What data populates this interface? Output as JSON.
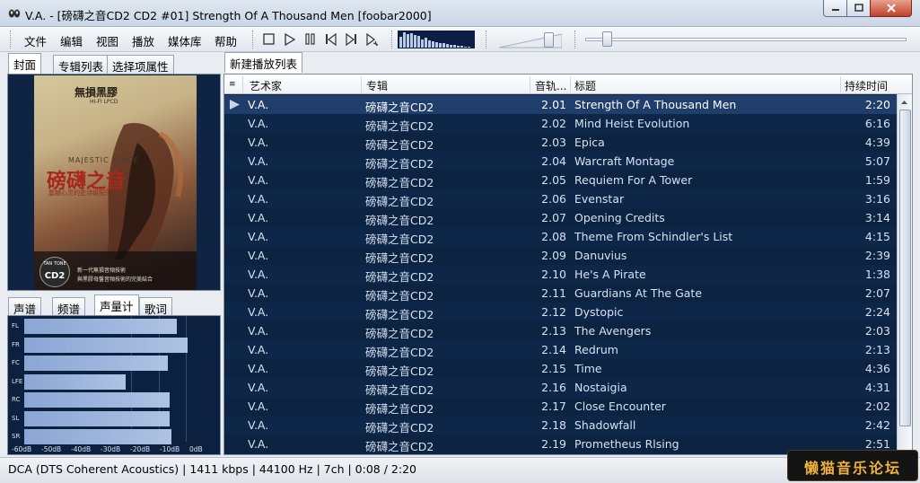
{
  "window": {
    "title": "V.A. - [磅礴之音CD2 CD2 #01] Strength Of A Thousand Men  [foobar2000]"
  },
  "menu": [
    "文件",
    "编辑",
    "视图",
    "播放",
    "媒体库",
    "帮助"
  ],
  "playback": {
    "volume_level": 0.85,
    "seek_position": 0.055
  },
  "left_tabs": [
    "封面",
    "专辑列表",
    "选择项属性"
  ],
  "cover": {
    "top_text": "無損黑膠",
    "sub_text": "HI-FI LPCD",
    "brand": "MAJESTIC VOICE",
    "title": "磅礴之音",
    "caption": "震撼心灵的史诗级配乐",
    "badge_logo": "TAN TONE",
    "badge_cd": "CD2",
    "bottom_line1": "新一代無損音頻技術",
    "bottom_line2": "與黑膠母盤音頻技術的完美結合"
  },
  "vis_tabs": [
    "声谱",
    "频谱",
    "声量计",
    "歌词"
  ],
  "meter": {
    "channels": [
      {
        "name": "FL",
        "level": 0.83
      },
      {
        "name": "FR",
        "level": 0.89
      },
      {
        "name": "FC",
        "level": 0.78
      },
      {
        "name": "LFE",
        "level": 0.55
      },
      {
        "name": "RC",
        "level": 0.79
      },
      {
        "name": "SL",
        "level": 0.79
      },
      {
        "name": "SR",
        "level": 0.8
      }
    ],
    "scale": [
      "-60dB",
      "-50dB",
      "-40dB",
      "-30dB",
      "-20dB",
      "-10dB",
      "0dB"
    ]
  },
  "playlist_tab": "新建播放列表",
  "columns": [
    "艺术家",
    "专辑",
    "音轨...",
    "标题",
    "持续时间"
  ],
  "tracks": [
    {
      "artist": "V.A.",
      "album": "磅礴之音CD2",
      "track": "2.01",
      "title": "Strength Of A Thousand Men",
      "duration": "2:20",
      "playing": true
    },
    {
      "artist": "V.A.",
      "album": "磅礴之音CD2",
      "track": "2.02",
      "title": "Mind Heist Evolution",
      "duration": "6:16"
    },
    {
      "artist": "V.A.",
      "album": "磅礴之音CD2",
      "track": "2.03",
      "title": "Epica",
      "duration": "4:39"
    },
    {
      "artist": "V.A.",
      "album": "磅礴之音CD2",
      "track": "2.04",
      "title": "Warcraft Montage",
      "duration": "5:07"
    },
    {
      "artist": "V.A.",
      "album": "磅礴之音CD2",
      "track": "2.05",
      "title": "Requiem For A Tower",
      "duration": "1:59"
    },
    {
      "artist": "V.A.",
      "album": "磅礴之音CD2",
      "track": "2.06",
      "title": "Evenstar",
      "duration": "3:16"
    },
    {
      "artist": "V.A.",
      "album": "磅礴之音CD2",
      "track": "2.07",
      "title": "Opening Credits",
      "duration": "3:14"
    },
    {
      "artist": "V.A.",
      "album": "磅礴之音CD2",
      "track": "2.08",
      "title": "Theme From Schindler's List",
      "duration": "4:15"
    },
    {
      "artist": "V.A.",
      "album": "磅礴之音CD2",
      "track": "2.09",
      "title": "Danuvius",
      "duration": "2:39"
    },
    {
      "artist": "V.A.",
      "album": "磅礴之音CD2",
      "track": "2.10",
      "title": "He's A Pirate",
      "duration": "1:38"
    },
    {
      "artist": "V.A.",
      "album": "磅礴之音CD2",
      "track": "2.11",
      "title": "Guardians At The Gate",
      "duration": "2:07"
    },
    {
      "artist": "V.A.",
      "album": "磅礴之音CD2",
      "track": "2.12",
      "title": "Dystopic",
      "duration": "2:24"
    },
    {
      "artist": "V.A.",
      "album": "磅礴之音CD2",
      "track": "2.13",
      "title": "The Avengers",
      "duration": "2:03"
    },
    {
      "artist": "V.A.",
      "album": "磅礴之音CD2",
      "track": "2.14",
      "title": "Redrum",
      "duration": "2:13"
    },
    {
      "artist": "V.A.",
      "album": "磅礴之音CD2",
      "track": "2.15",
      "title": "Time",
      "duration": "4:36"
    },
    {
      "artist": "V.A.",
      "album": "磅礴之音CD2",
      "track": "2.16",
      "title": "Nostaigia",
      "duration": "4:31"
    },
    {
      "artist": "V.A.",
      "album": "磅礴之音CD2",
      "track": "2.17",
      "title": "Close Encounter",
      "duration": "2:02"
    },
    {
      "artist": "V.A.",
      "album": "磅礴之音CD2",
      "track": "2.18",
      "title": "Shadowfall",
      "duration": "2:42"
    },
    {
      "artist": "V.A.",
      "album": "磅礴之音CD2",
      "track": "2.19",
      "title": "Prometheus Rlsing",
      "duration": "2:51"
    }
  ],
  "status": "DCA (DTS Coherent Acoustics) | 1411 kbps | 44100 Hz | 7ch | 0:08 / 2:20",
  "watermark": "懒猫音乐论坛",
  "colors": {
    "playlist_bg": "#0c2342",
    "playing_row": "#1f3e6c",
    "meter_bar": "#8aa6d4",
    "watermark_text": "#f2b13c"
  }
}
